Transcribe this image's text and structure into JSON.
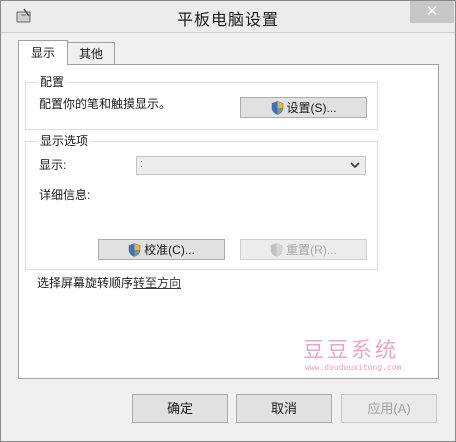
{
  "window": {
    "title": "平板电脑设置",
    "close_glyph": "✕",
    "app_icon": "tablet-pen-icon"
  },
  "tabs": [
    {
      "label": "显示",
      "active": true
    },
    {
      "label": "其他",
      "active": false
    }
  ],
  "config_group": {
    "label": "配置",
    "description": "配置你的笔和触摸显示。",
    "setup_button": "设置(S)..."
  },
  "display_options": {
    "label": "显示选项",
    "display_label": "显示:",
    "display_value": ":",
    "details_label": "详细信息:",
    "calibrate_button": "校准(C)...",
    "reset_button": "重置(R)..."
  },
  "rotation": {
    "prefix": "选择屏幕旋转顺序",
    "link": "转至方向"
  },
  "watermark": {
    "name": "豆豆系统",
    "url": "www.doudouxitong.com"
  },
  "footer": {
    "ok": "确定",
    "cancel": "取消",
    "apply": "应用(A)"
  },
  "colors": {
    "accent_shield_blue": "#3b73c4",
    "accent_shield_yellow": "#e8b53a",
    "watermark": "#e6a7c8"
  }
}
